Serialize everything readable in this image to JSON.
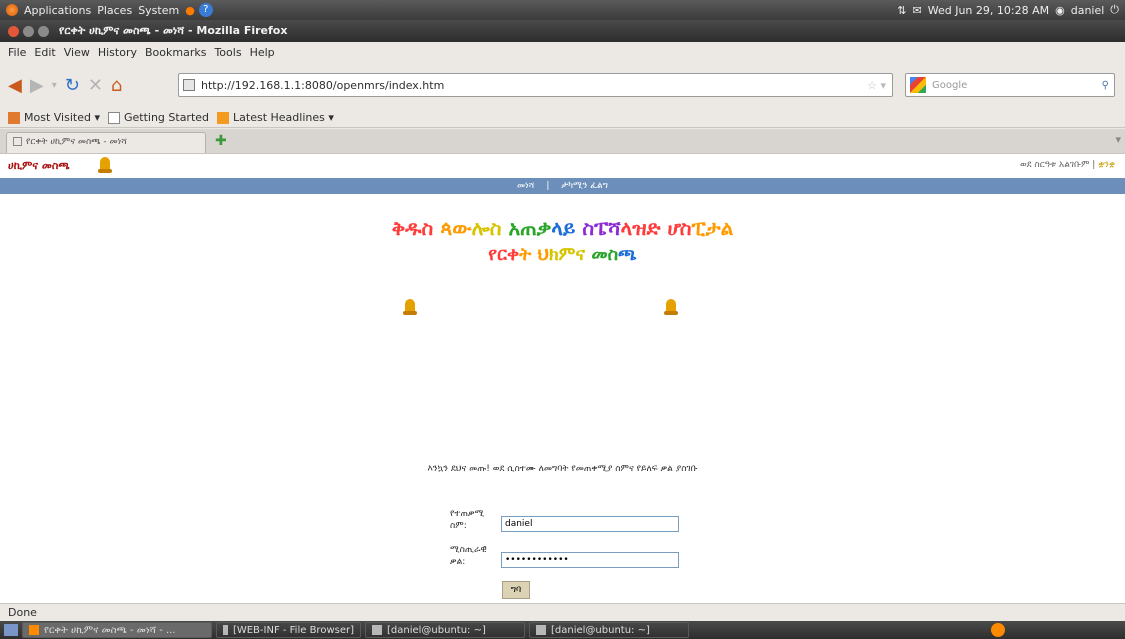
{
  "gnome_panel": {
    "menus": [
      "Applications",
      "Places",
      "System"
    ],
    "clock": "Wed Jun 29, 10:28 AM",
    "user": "daniel"
  },
  "window": {
    "title": "የርቀት ሀኪምና መስጫ - መነሻ - Mozilla Firefox"
  },
  "menubar": [
    "File",
    "Edit",
    "View",
    "History",
    "Bookmarks",
    "Tools",
    "Help"
  ],
  "navbar": {
    "url": "http://192.168.1.1:8080/openmrs/index.htm",
    "search_placeholder": "Google"
  },
  "bookmarks": [
    "Most Visited ▾",
    "Getting Started",
    "Latest Headlines ▾"
  ],
  "tab": {
    "label": "የርቀት ሀኪምና መስጫ - መነሻ"
  },
  "app": {
    "logo": "ሀኪምና መስጫ",
    "user_info": "ወደ ስርዓቱ አልገቡም",
    "user_links": [
      "|",
      "ቋንቋ"
    ],
    "nav": [
      "መነሻ",
      "ታካሚን ፈልግ"
    ],
    "title_line1": "ቅዱስ ጳውሎስ አጠቃላይ ስፔሻላዝድ ሆስፒታል",
    "title_line2": "የርቀት ህክምና መስጫ",
    "prompt": "እንኳን ደህና መጡ! ወደ ሲስተሙ ለመግባት የመጠቀሚያ ስምና የይለፍ ቃል ያስገቡ",
    "username_label": "የተጠቃሚ ስም:",
    "username_value": "daniel",
    "password_label": "ሚስጢራዊ ቃል:",
    "password_value": "••••••••••••",
    "login_button": "ግባ"
  },
  "statusbar": {
    "text": "Done"
  },
  "taskbar": [
    "የርቀት ሀኪምና መስጫ - መነሻ - ...",
    "[WEB-INF - File Browser]",
    "[daniel@ubuntu: ~]",
    "[daniel@ubuntu: ~]"
  ],
  "colors": {
    "app_nav": "#6b8fba",
    "title_gradient": [
      "#ff3b3b",
      "#ff9a00",
      "#d7c400",
      "#2aa52a",
      "#1c6fd6",
      "#8b2bd6",
      "#ff3b3b"
    ]
  }
}
